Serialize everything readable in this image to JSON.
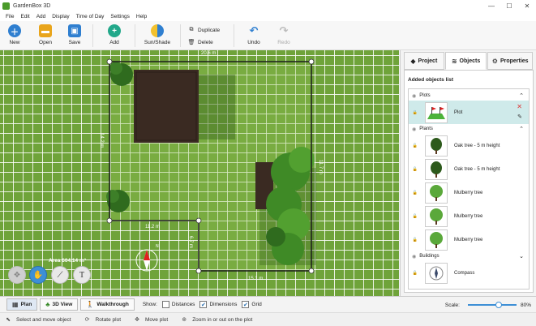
{
  "window": {
    "title": "GardenBox 3D",
    "controls": [
      "—",
      "☐",
      "✕"
    ]
  },
  "menu": [
    "File",
    "Edit",
    "Add",
    "Display",
    "Time of Day",
    "Settings",
    "Help"
  ],
  "toolbar": {
    "new": "New",
    "open": "Open",
    "save": "Save",
    "add": "Add",
    "sun_shade": "Sun/Shade",
    "duplicate": "Duplicate",
    "delete": "Delete",
    "undo": "Undo",
    "redo": "Redo"
  },
  "canvas": {
    "dim_top": "20.6 m",
    "dim_left": "14.2 m",
    "dim_right": "11.7 m",
    "dim_mid": "11.2 m",
    "dim_inner": "6.7 m",
    "dim_bottom": "15.1 m",
    "area": "Area 604.14 m²"
  },
  "view_tabs": {
    "plan": "Plan",
    "view3d": "3D View",
    "walkthrough": "Walkthrough"
  },
  "show": {
    "label": "Show:",
    "distances": "Distances",
    "dimensions": "Dimensions",
    "grid": "Grid",
    "distances_checked": false,
    "dimensions_checked": true,
    "grid_checked": true
  },
  "scale": {
    "label": "Scale:",
    "value": "80%",
    "level": 0.8
  },
  "status": {
    "select": "Select and move object",
    "rotate": "Rotate plot",
    "move": "Move plot",
    "zoom": "Zoom in or out on the plot"
  },
  "panel": {
    "tabs": {
      "project": "Project",
      "objects": "Objects",
      "properties": "Properties"
    },
    "list_title": "Added objects list",
    "groups": {
      "plots": "Plots",
      "plants": "Plants",
      "buildings": "Buildings"
    },
    "plot_item": "Plot",
    "plants": [
      "Oak tree - 5 m height",
      "Oak tree - 5 m height",
      "Mulberry tree",
      "Mulberry tree",
      "Mulberry tree"
    ],
    "building_item": "Compass"
  }
}
